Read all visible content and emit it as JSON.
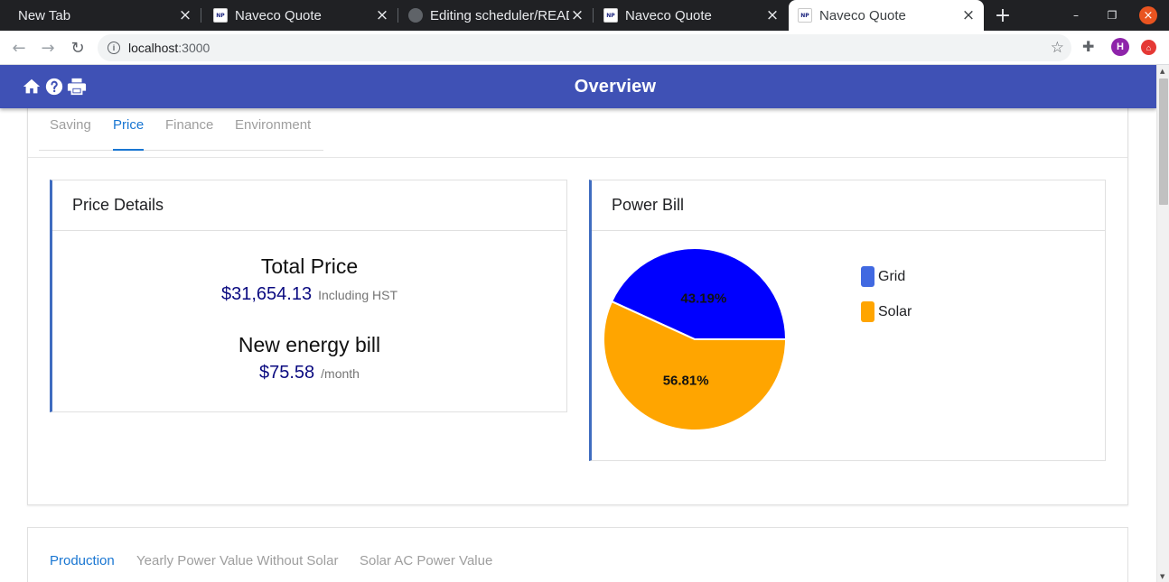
{
  "browser": {
    "tabs": [
      {
        "title": "New Tab",
        "favicon": "none",
        "active": false
      },
      {
        "title": "Naveco Quote",
        "favicon": "naveco-icon",
        "active": false
      },
      {
        "title": "Editing scheduler/README",
        "favicon": "github-icon",
        "active": false
      },
      {
        "title": "Naveco Quote",
        "favicon": "naveco-icon",
        "active": false
      },
      {
        "title": "Naveco Quote",
        "favicon": "naveco-icon",
        "active": true
      }
    ],
    "favicon_text": "NP",
    "url_host": "localhost",
    "url_port": ":3000",
    "profile_initial": "H"
  },
  "appbar": {
    "title": "Overview",
    "icons": [
      "home-icon",
      "help-icon",
      "print-icon"
    ],
    "color": "#3f51b5"
  },
  "top_tabs": [
    {
      "label": "Saving",
      "selected": false
    },
    {
      "label": "Price",
      "selected": true
    },
    {
      "label": "Finance",
      "selected": false
    },
    {
      "label": "Environment",
      "selected": false
    }
  ],
  "price_details": {
    "title": "Price Details",
    "total_label": "Total Price",
    "total_value": "$31,654.13",
    "total_note": "Including HST",
    "bill_label": "New energy bill",
    "bill_value": "$75.58",
    "bill_unit": "/month"
  },
  "power_bill": {
    "title": "Power Bill"
  },
  "chart_data": {
    "type": "pie",
    "title": "",
    "slices": [
      {
        "name": "Grid",
        "value": 43.19,
        "label": "43.19%",
        "color": "#0000ff"
      },
      {
        "name": "Solar",
        "value": 56.81,
        "label": "56.81%",
        "color": "#ffa500"
      }
    ],
    "legend_placement": "right",
    "legend_colors": {
      "Grid": "#4169e1",
      "Solar": "#ffa500"
    }
  },
  "bottom_tabs": [
    {
      "label": "Production",
      "selected": true
    },
    {
      "label": "Yearly Power Value Without Solar",
      "selected": false
    },
    {
      "label": "Solar AC Power Value",
      "selected": false
    }
  ]
}
